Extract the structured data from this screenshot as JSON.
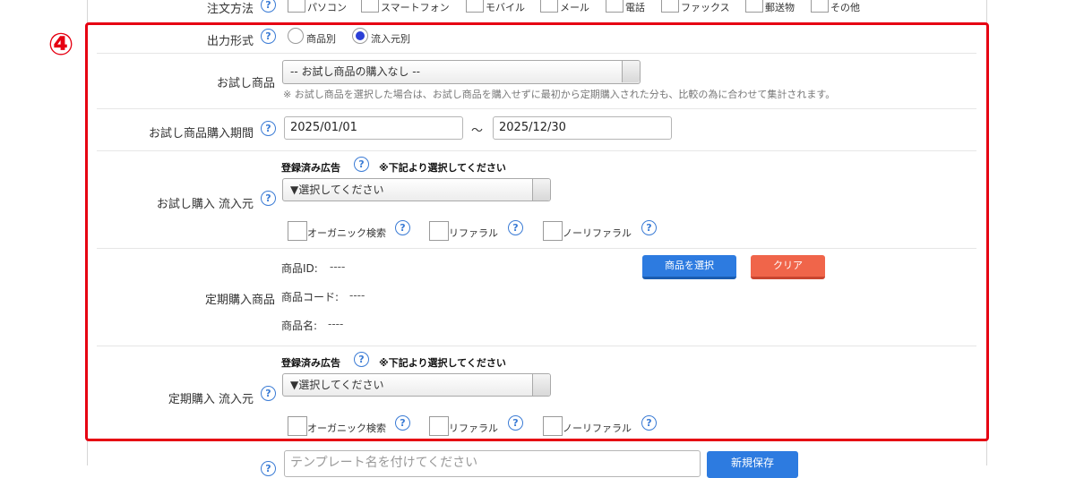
{
  "order_method": {
    "label": "注文方法",
    "options": [
      "パソコン",
      "スマートフォン",
      "モバイル",
      "メール",
      "電話",
      "ファックス",
      "郵送物",
      "その他"
    ]
  },
  "section_marker": "④",
  "output_format": {
    "label": "出力形式",
    "options": [
      "商品別",
      "流入元別"
    ],
    "selected": "流入元別"
  },
  "trial_product": {
    "label": "お試し商品",
    "select_value": "-- お試し商品の購入なし --",
    "note": "※ お試し商品を選択した場合は、お試し商品を購入せずに最初から定期購入された分も、比較の為に合わせて集計されます。"
  },
  "trial_period": {
    "label": "お試し商品購入期間",
    "start": "2025/01/01",
    "separator": "～",
    "end": "2025/12/30"
  },
  "trial_source": {
    "label": "お試し購入 流入元",
    "registered_ads": "登録済み広告",
    "instruction": "※下記より選択してください",
    "select_value": "▼選択してください",
    "checkboxes": [
      "オーガニック検索",
      "リファラル",
      "ノーリファラル"
    ]
  },
  "subscription_product": {
    "label": "定期購入商品",
    "id_label": "商品ID:",
    "id_value": "----",
    "code_label": "商品コード:",
    "code_value": "----",
    "name_label": "商品名:",
    "name_value": "----",
    "select_button": "商品を選択",
    "clear_button": "クリア"
  },
  "subscription_source": {
    "label": "定期購入 流入元",
    "registered_ads": "登録済み広告",
    "instruction": "※下記より選択してください",
    "select_value": "▼選択してください",
    "checkboxes": [
      "オーガニック検索",
      "リファラル",
      "ノーリファラル"
    ]
  },
  "template": {
    "placeholder": "テンプレート名を付けてください",
    "save_button": "新規保存"
  },
  "colors": {
    "highlight_border": "#e60012",
    "primary_button": "#2d7be0",
    "clear_button": "#f0654a",
    "help_icon": "#3a7bd5"
  }
}
